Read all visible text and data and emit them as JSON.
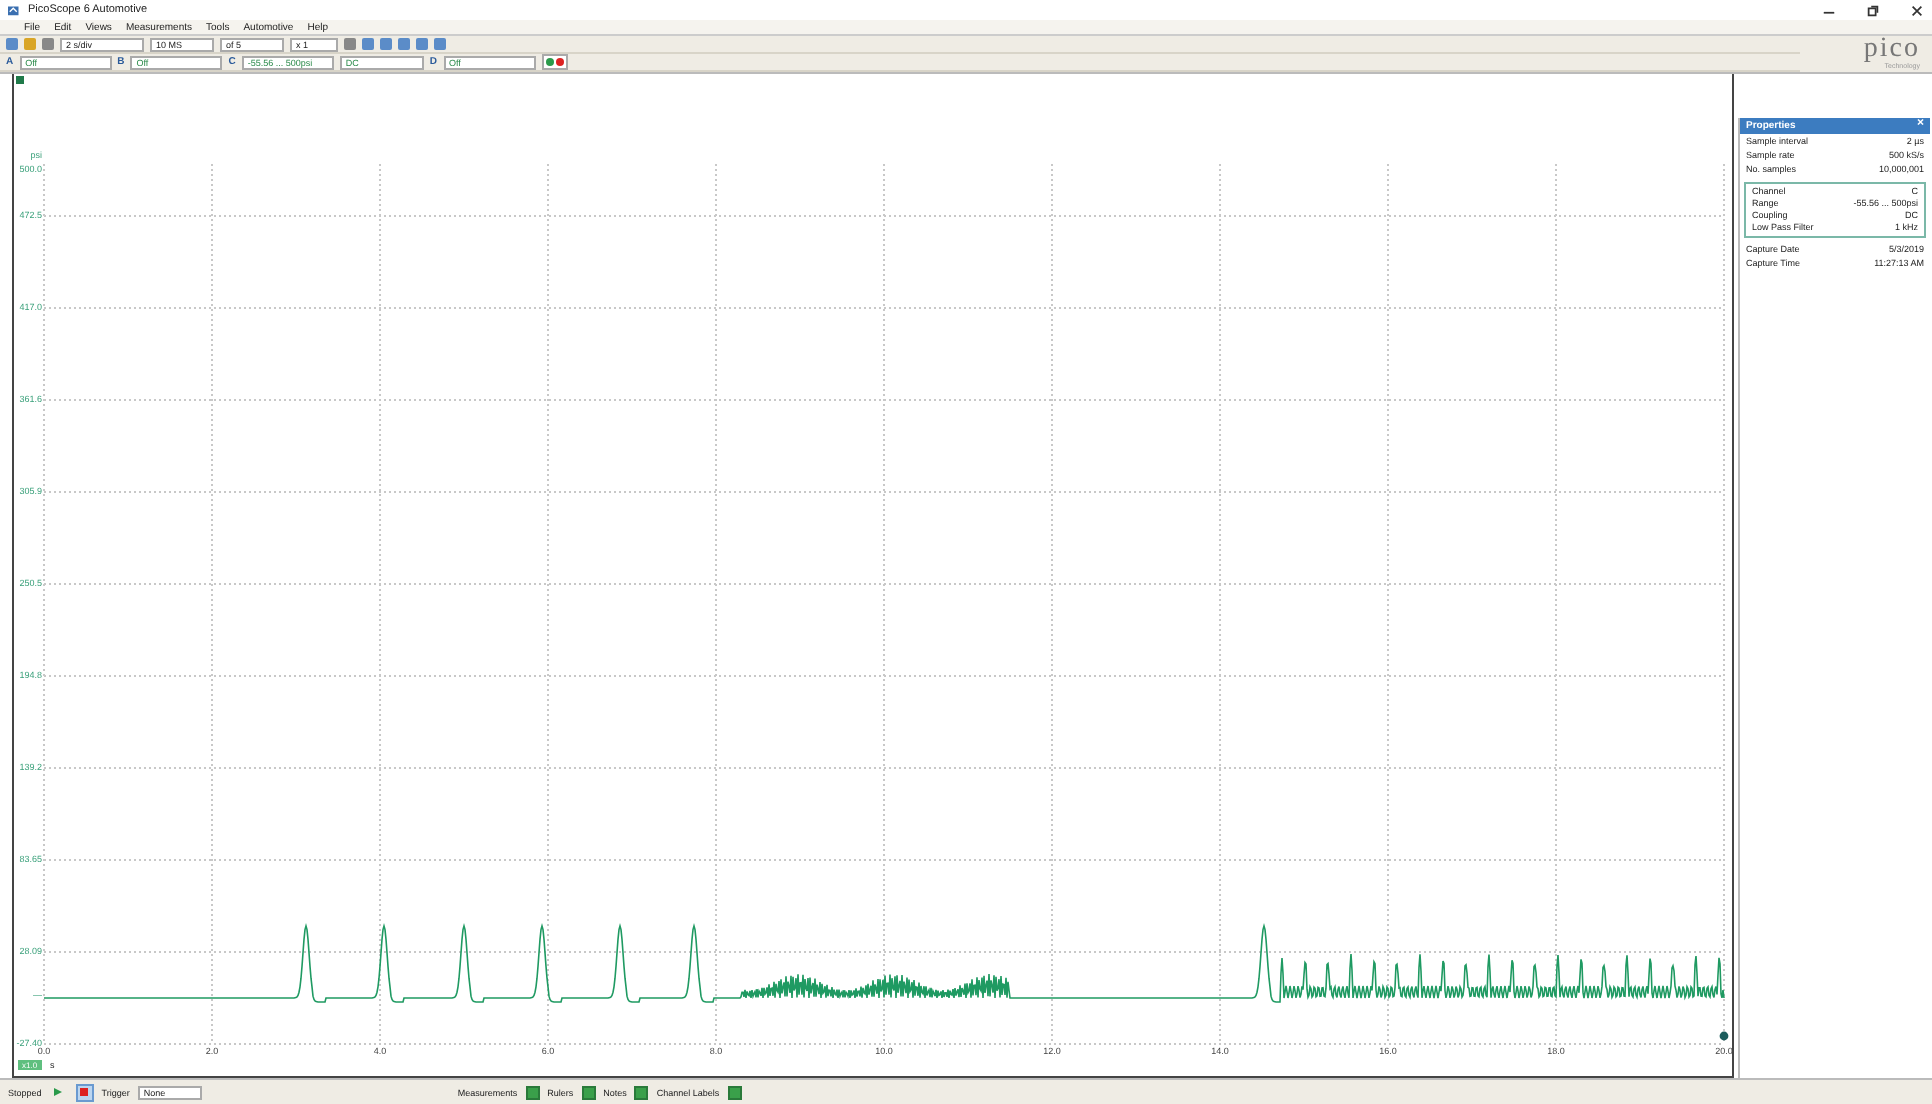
{
  "window": {
    "title": "PicoScope 6 Automotive"
  },
  "menu": [
    "File",
    "Edit",
    "Views",
    "Measurements",
    "Tools",
    "Automotive",
    "Help"
  ],
  "toolbar": {
    "timebase": "2 s/div",
    "samples": "10 MS",
    "buffer": "of 5",
    "zoom": "x 1"
  },
  "channels": [
    {
      "name": "A",
      "range": "Off"
    },
    {
      "name": "B",
      "range": "Off"
    },
    {
      "name": "C",
      "range": "-55.56 ... 500psi",
      "coupling": "DC"
    },
    {
      "name": "D",
      "range": "Off"
    }
  ],
  "logo": {
    "name": "pico",
    "tagline": "Technology"
  },
  "plot": {
    "unit": "psi",
    "y_labels": [
      "500.0",
      "472.5",
      "417.0",
      "361.6",
      "305.9",
      "250.5",
      "194.8",
      "139.2",
      "83.65",
      "28.09",
      "-27.40"
    ],
    "x_labels": [
      "0.0",
      "2.0",
      "4.0",
      "6.0",
      "8.0",
      "10.0",
      "12.0",
      "14.0",
      "16.0",
      "18.0",
      "20.0"
    ],
    "x_scale": "x1.0",
    "x_unit": "s",
    "zero_marker": "—"
  },
  "properties": {
    "title": "Properties",
    "close": "×",
    "sample_rows": [
      {
        "label": "Sample interval",
        "value": "2 µs"
      },
      {
        "label": "Sample rate",
        "value": "500 kS/s"
      },
      {
        "label": "No. samples",
        "value": "10,000,001"
      }
    ],
    "channel_rows": [
      {
        "label": "Channel",
        "value": "C"
      },
      {
        "label": "Range",
        "value": "-55.56 ... 500psi"
      },
      {
        "label": "Coupling",
        "value": "DC"
      },
      {
        "label": "Low Pass Filter",
        "value": "1 kHz"
      }
    ],
    "capture_rows": [
      {
        "label": "Capture Date",
        "value": "5/3/2019"
      },
      {
        "label": "Capture Time",
        "value": "11:27:13 AM"
      }
    ]
  },
  "status_bar": {
    "state": "Stopped",
    "run_buttons": [
      {
        "kind": "play",
        "selected": false
      },
      {
        "kind": "stop",
        "selected": true
      }
    ],
    "trigger_label": "Trigger",
    "trigger_mode": "None",
    "toggles": [
      {
        "label": "Measurements"
      },
      {
        "label": "Rulers"
      },
      {
        "label": "Notes"
      },
      {
        "label": "Channel Labels"
      }
    ]
  }
}
